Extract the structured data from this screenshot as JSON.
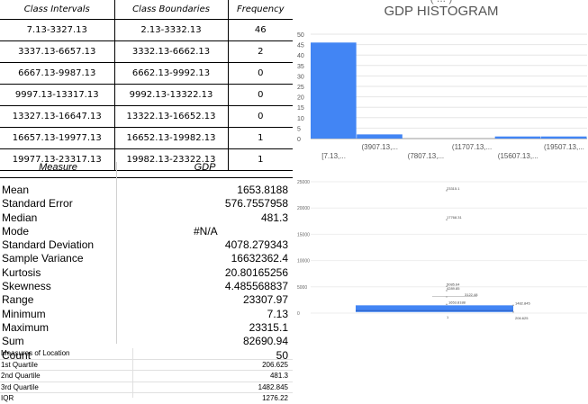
{
  "freq_table": {
    "headers": [
      "Class Intervals",
      "Class Boundaries",
      "Frequency"
    ],
    "rows": [
      [
        "7.13-3327.13",
        "2.13-3332.13",
        "46"
      ],
      [
        "3337.13-6657.13",
        "3332.13-6662.13",
        "2"
      ],
      [
        "6667.13-9987.13",
        "6662.13-9992.13",
        "0"
      ],
      [
        "9997.13-13317.13",
        "9992.13-13322.13",
        "0"
      ],
      [
        "13327.13-16647.13",
        "13322.13-16652.13",
        "0"
      ],
      [
        "16657.13-19977.13",
        "16652.13-19982.13",
        "1"
      ],
      [
        "19977.13-23317.13",
        "19982.13-23322.13",
        "1"
      ]
    ]
  },
  "measures": {
    "header_measure": "Measure",
    "header_gdp": "GDP",
    "rows": [
      {
        "label": "Mean",
        "value": "1653.8188"
      },
      {
        "label": "Standard Error",
        "value": "576.7557958"
      },
      {
        "label": "Median",
        "value": "481.3"
      },
      {
        "label": "Mode",
        "value": "#N/A"
      },
      {
        "label": "Standard Deviation",
        "value": "4078.279343"
      },
      {
        "label": "Sample Variance",
        "value": "16632362.4"
      },
      {
        "label": "Kurtosis",
        "value": "20.80165256"
      },
      {
        "label": "Skewness",
        "value": "4.485568837"
      },
      {
        "label": "Range",
        "value": "23307.97"
      },
      {
        "label": "Minimum",
        "value": "7.13"
      },
      {
        "label": "Maximum",
        "value": "23315.1"
      },
      {
        "label": "Sum",
        "value": "82690.94"
      },
      {
        "label": "Count",
        "value": "50"
      }
    ]
  },
  "location": {
    "title": "Measures of Location",
    "rows": [
      {
        "label": "1st Quartile",
        "value": "206.625"
      },
      {
        "label": "2nd Quartile",
        "value": "481.3"
      },
      {
        "label": "3rd Quartile",
        "value": "1482.845"
      },
      {
        "label": "IQR",
        "value": "1276.22"
      }
    ]
  },
  "chart_data": [
    {
      "type": "bar",
      "title": "GDP HISTOGRAM",
      "categories": [
        "[7.13,...",
        "(3907.13,...",
        "(7807.13,...",
        "(11707.13,...",
        "(15607.13,...",
        "(19507.13,..."
      ],
      "values": [
        46,
        2,
        0,
        0,
        1,
        1
      ],
      "ylim": [
        0,
        50
      ],
      "yticks": [
        0,
        5,
        10,
        15,
        20,
        25,
        30,
        35,
        40,
        45,
        50
      ],
      "color": "#4285f4",
      "grid": true
    },
    {
      "type": "box",
      "yticks": [
        0,
        5000,
        10000,
        15000,
        20000,
        25000
      ],
      "ylim": [
        0,
        25000
      ],
      "box": {
        "q1": 206.625,
        "q3": 1482.845,
        "median": 481.3,
        "mean": 1653.8188
      },
      "color": "#4285f4",
      "outliers": [
        {
          "value": 23315.1,
          "label": "23315.1"
        },
        {
          "value": 17768.31,
          "label": "17768.31"
        },
        {
          "value": 5085.64,
          "label": "5085.64"
        },
        {
          "value": 4289.85,
          "label": "4289.85"
        },
        {
          "value": 3122.48,
          "label": "3122.48"
        },
        {
          "value": 1653.8188,
          "label": "1653.8188"
        },
        {
          "value": 1482.845,
          "label": "1482.845"
        },
        {
          "value": 206.625,
          "label": "206.625"
        }
      ],
      "lower_label": "1"
    }
  ]
}
